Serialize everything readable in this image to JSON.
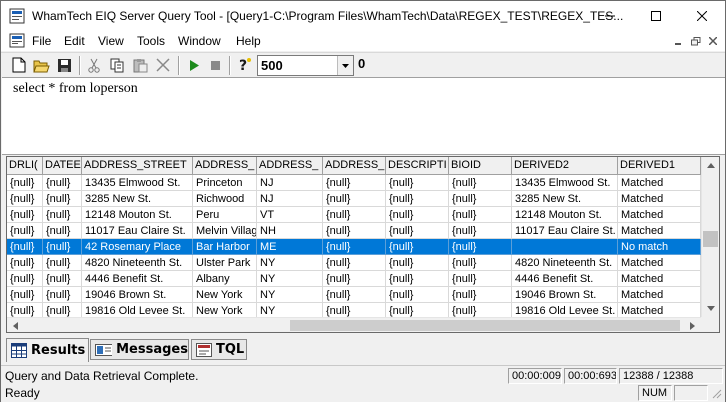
{
  "window": {
    "title": "WhamTech EIQ Server Query Tool - [Query1-C:\\Program Files\\WhamTech\\Data\\REGEX_TEST\\REGEX_TES..."
  },
  "menu": {
    "items": [
      "File",
      "Edit",
      "View",
      "Tools",
      "Window",
      "Help"
    ]
  },
  "toolbar": {
    "row_limit": "500",
    "row_count": "0",
    "icons": [
      "new-document-icon",
      "open-folder-icon",
      "save-icon",
      "cut-icon",
      "copy-icon",
      "paste-icon",
      "delete-icon",
      "run-icon",
      "stop-icon",
      "help-icon"
    ]
  },
  "editor": {
    "query": "select * from loperson"
  },
  "grid": {
    "columns": [
      "DRLI(",
      "DATEE",
      "ADDRESS_STREET",
      "ADDRESS_",
      "ADDRESS_",
      "ADDRESS_",
      "DESCRIPTI",
      "BIOID",
      "DERIVED2",
      "DERIVED1"
    ],
    "rows": [
      [
        "{null}",
        "{null}",
        "13435 Elmwood St.",
        "Princeton",
        "NJ",
        "{null}",
        "{null}",
        "{null}",
        "13435 Elmwood St.",
        "Matched"
      ],
      [
        "{null}",
        "{null}",
        "3285 New St.",
        "Richwood",
        "NJ",
        "{null}",
        "{null}",
        "{null}",
        "3285 New St.",
        "Matched"
      ],
      [
        "{null}",
        "{null}",
        "12148 Mouton St.",
        "Peru",
        "VT",
        "{null}",
        "{null}",
        "{null}",
        "12148 Mouton St.",
        "Matched"
      ],
      [
        "{null}",
        "{null}",
        "11017 Eau Claire St.",
        "Melvin Villag",
        "NH",
        "{null}",
        "{null}",
        "{null}",
        "11017 Eau Claire St.",
        "Matched"
      ],
      [
        "{null}",
        "{null}",
        "42 Rosemary Place",
        "Bar Harbor",
        "ME",
        "{null}",
        "{null}",
        "{null}",
        "",
        "No match"
      ],
      [
        "{null}",
        "{null}",
        "4820 Nineteenth St.",
        "Ulster Park",
        "NY",
        "{null}",
        "{null}",
        "{null}",
        "4820 Nineteenth St.",
        "Matched"
      ],
      [
        "{null}",
        "{null}",
        "4446 Benefit St.",
        "Albany",
        "NY",
        "{null}",
        "{null}",
        "{null}",
        "4446 Benefit St.",
        "Matched"
      ],
      [
        "{null}",
        "{null}",
        "19046 Brown St.",
        "New York",
        "NY",
        "{null}",
        "{null}",
        "{null}",
        "19046 Brown St.",
        "Matched"
      ],
      [
        "{null}",
        "{null}",
        "19816 Old Levee St.",
        "New York",
        "NY",
        "{null}",
        "{null}",
        "{null}",
        "19816 Old Levee St.",
        "Matched"
      ]
    ],
    "selected_row": 4,
    "selection_color": "#0078d7"
  },
  "tabs": [
    {
      "label": "Results",
      "icon": "grid-icon"
    },
    {
      "label": "Messages",
      "icon": "messages-icon"
    },
    {
      "label": "TQL",
      "icon": "tql-icon"
    }
  ],
  "status": {
    "message": "Query and Data Retrieval Complete.",
    "time1": "00:00:009",
    "time2": "00:00:693",
    "rows": "12388 / 12388",
    "ready": "Ready",
    "num": "NUM"
  }
}
